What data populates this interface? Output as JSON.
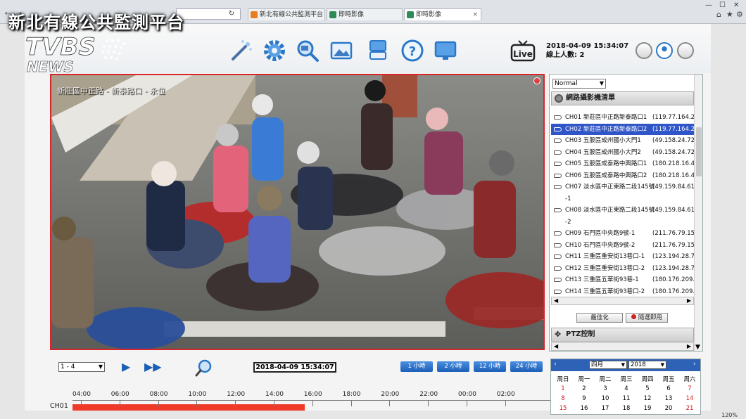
{
  "overlay": {
    "title": "新北有線公共監測平台"
  },
  "browser": {
    "address": "",
    "tabs": [
      {
        "label": "新北有線公共監測平台",
        "active": false
      },
      {
        "label": "即時影像",
        "active": false
      },
      {
        "label": "即時影像",
        "active": true
      }
    ],
    "status_zoom": "120%"
  },
  "header": {
    "datetime": "2018-04-09 15:34:07",
    "online_users": "線上人數: 2",
    "icons": [
      "wand-icon",
      "gear-icon",
      "camera-search-icon",
      "picture-icon",
      "monitor-stack-icon",
      "help-icon",
      "display-icon"
    ]
  },
  "video": {
    "caption": "新莊區中正路 - 新泰路口 - 永位"
  },
  "panel": {
    "mode": "Normal",
    "camera_list_title": "網路攝影機清單",
    "ptz_title": "PTZ控制",
    "cameras": [
      {
        "label": "CH01 新莊區中正路新泰路口1",
        "ip": "(119.77.164.2",
        "selected": false,
        "tall": false
      },
      {
        "label": "CH02 新莊區中正路新泰路口2",
        "ip": "(119.77.164.2",
        "selected": true,
        "tall": false
      },
      {
        "label": "CH03 五股區成州國小大門1",
        "ip": "(49.158.24.72",
        "selected": false,
        "tall": false
      },
      {
        "label": "CH04 五股區成州國小大門2",
        "ip": "(49.158.24.72",
        "selected": false,
        "tall": false
      },
      {
        "label": "CH05 五股區成泰路中興路口1",
        "ip": "(180.218.16.4",
        "selected": false,
        "tall": false
      },
      {
        "label": "CH06 五股區成泰路中興路口2",
        "ip": "(180.218.16.4",
        "selected": false,
        "tall": false
      },
      {
        "label": "CH07 淡水區中正東路二段145號",
        "label2": "-1",
        "ip": "(49.159.84.61",
        "selected": false,
        "tall": true
      },
      {
        "label": "CH08 淡水區中正東路二段145號",
        "label2": "-2",
        "ip": "(49.159.84.61",
        "selected": false,
        "tall": true
      },
      {
        "label": "CH09 石門區中央路9號-1",
        "ip": "(211.76.79.15",
        "selected": false,
        "tall": false
      },
      {
        "label": "CH10 石門區中央路9號-2",
        "ip": "(211.76.79.15",
        "selected": false,
        "tall": false
      },
      {
        "label": "CH11 三重區重安街13巷口-1",
        "ip": "(123.194.28.7",
        "selected": false,
        "tall": false
      },
      {
        "label": "CH12 三重區重安街13巷口-2",
        "ip": "(123.194.28.7",
        "selected": false,
        "tall": false
      },
      {
        "label": "CH13 三重區五華街93巷-1",
        "ip": "(180.176.209.",
        "selected": false,
        "tall": false
      },
      {
        "label": "CH14 三重區五華街93巷口-2",
        "ip": "(180.176.209.",
        "selected": false,
        "tall": false
      }
    ],
    "optimize_label": "最佳化",
    "instant_play_label": "隨選即用"
  },
  "controls": {
    "range": "1 - 4",
    "timestamp": "2018-04-09 15:34:07",
    "hour_buttons": [
      "1 小時",
      "2 小時",
      "12 小時",
      "24 小時"
    ]
  },
  "timeline": {
    "channel": "CH01",
    "labels": [
      "04:00",
      "06:00",
      "08:00",
      "10:00",
      "12:00",
      "14:00",
      "16:00",
      "18:00",
      "20:00",
      "22:00",
      "00:00",
      "02:00"
    ],
    "recorded_fraction": 0.485
  },
  "calendar": {
    "month": "四月",
    "year": "2018",
    "weekdays": [
      "周日",
      "周一",
      "周二",
      "周三",
      "周四",
      "周五",
      "周六"
    ],
    "rows": [
      [
        "1",
        "2",
        "3",
        "4",
        "5",
        "6",
        "7"
      ],
      [
        "8",
        "9",
        "10",
        "11",
        "12",
        "13",
        "14"
      ],
      [
        "15",
        "16",
        "17",
        "18",
        "19",
        "20",
        "21"
      ]
    ],
    "colors": {
      "holiday": "#d02020",
      "normal": "#111111"
    }
  },
  "colors": {
    "accent": "#2d62b7",
    "selected_row": "#2f55c8",
    "timeline_fill": "#ef3a2a",
    "video_border": "#d7262b"
  }
}
